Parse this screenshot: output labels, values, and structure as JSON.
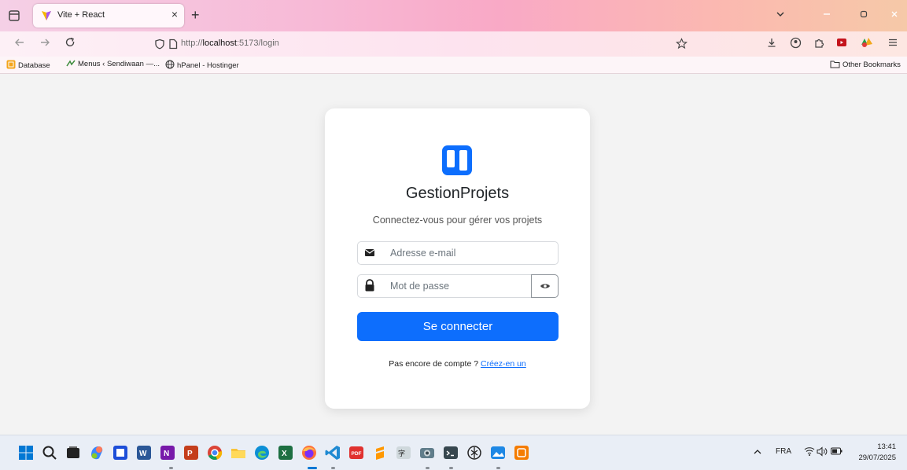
{
  "browser": {
    "tab_title": "Vite + React",
    "tab_close": "×",
    "new_tab": "+",
    "url_prefix": "http://",
    "url_host": "localhost",
    "url_path": ":5173/login",
    "bookmarks": [
      {
        "label": "Database",
        "icon": "spreadsheet-icon"
      },
      {
        "label": "Menus ‹ Sendiwaan —...",
        "icon": "menu-site-icon"
      },
      {
        "label": "hPanel - Hostinger",
        "icon": "globe-icon"
      }
    ],
    "other_bookmarks": "Other Bookmarks"
  },
  "login": {
    "app_name": "GestionProjets",
    "subtitle": "Connectez-vous pour gérer vos projets",
    "email_placeholder": "Adresse e-mail",
    "password_placeholder": "Mot de passe",
    "submit_label": "Se connecter",
    "signup_prompt": "Pas encore de compte ? ",
    "signup_link": "Créez-en un"
  },
  "taskbar": {
    "language": "FRA",
    "time": "13:41",
    "date": "29/07/2025"
  },
  "colors": {
    "primary": "#0d6efd",
    "page_background": "#f3f3f3"
  }
}
